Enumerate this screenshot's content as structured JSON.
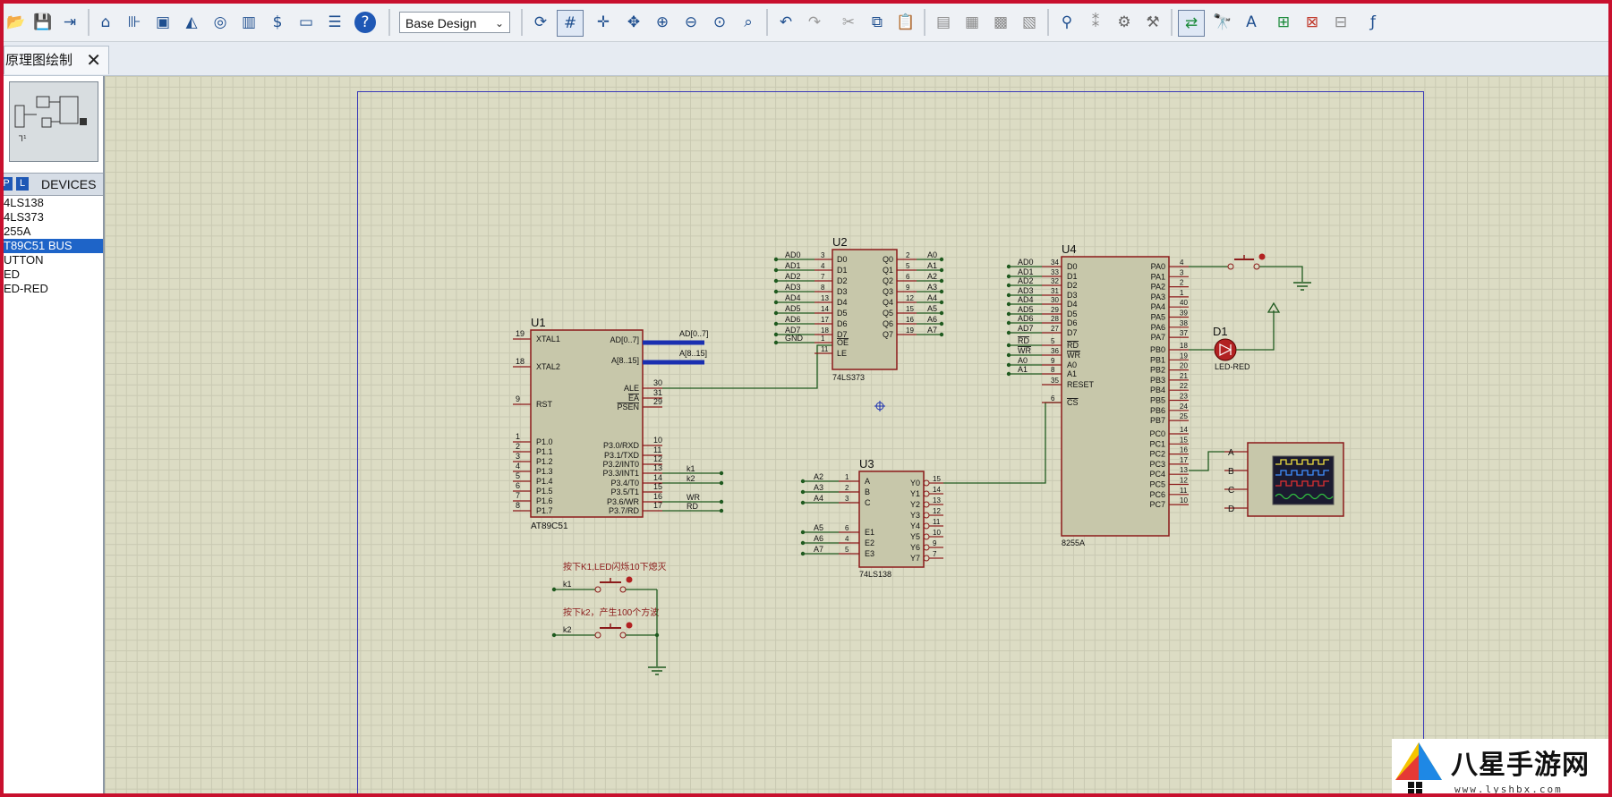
{
  "toolbar": {
    "design_select": "Base Design",
    "icons": [
      "new-folder-icon",
      "save-icon",
      "import-icon",
      "home-icon",
      "schematic-icon",
      "pcb-icon",
      "3d-icon",
      "gerber-icon",
      "bom-icon",
      "cost-icon",
      "vsm-icon",
      "netlist-icon",
      "help-icon",
      "refresh-icon",
      "grid-icon",
      "origin-icon",
      "pan-icon",
      "zoom-in-icon",
      "zoom-out-icon",
      "zoom-all-icon",
      "zoom-area-icon",
      "undo-icon",
      "redo-icon",
      "cut-icon",
      "copy-icon",
      "paste-icon",
      "block-copy-icon",
      "block-move-icon",
      "block-rotate-icon",
      "block-delete-icon",
      "pick-device-icon",
      "make-device-icon",
      "packaging-icon",
      "decompose-icon",
      "wire-autorouter-icon",
      "search-icon",
      "property-assign-icon",
      "new-sheet-icon",
      "delete-sheet-icon",
      "goto-sheet-icon",
      "script-icon"
    ]
  },
  "tab": {
    "title": "原理图绘制",
    "close": "✕"
  },
  "panel": {
    "p_label": "P",
    "l_label": "L",
    "devices_label": "DEVICES",
    "devices": [
      "4LS138",
      "4LS373",
      "255A",
      "T89C51 BUS",
      "UTTON",
      "ED",
      "ED-RED"
    ],
    "selected_index": 3
  },
  "schematic": {
    "u1": {
      "ref": "U1",
      "part": "AT89C51",
      "left_pins": [
        {
          "num": "19",
          "name": "XTAL1"
        },
        {
          "num": "18",
          "name": "XTAL2"
        },
        {
          "num": "9",
          "name": "RST"
        },
        {
          "num": "1",
          "name": "P1.0"
        },
        {
          "num": "2",
          "name": "P1.1"
        },
        {
          "num": "3",
          "name": "P1.2"
        },
        {
          "num": "4",
          "name": "P1.3"
        },
        {
          "num": "5",
          "name": "P1.4"
        },
        {
          "num": "6",
          "name": "P1.5"
        },
        {
          "num": "7",
          "name": "P1.6"
        },
        {
          "num": "8",
          "name": "P1.7"
        }
      ],
      "right_pins": [
        {
          "num": "",
          "name": "AD[0..7]"
        },
        {
          "num": "",
          "name": "A[8..15]"
        },
        {
          "num": "30",
          "name": "ALE"
        },
        {
          "num": "31",
          "name": "EA"
        },
        {
          "num": "29",
          "name": "PSEN"
        },
        {
          "num": "10",
          "name": "P3.0/RXD"
        },
        {
          "num": "11",
          "name": "P3.1/TXD"
        },
        {
          "num": "12",
          "name": "P3.2/INT0"
        },
        {
          "num": "13",
          "name": "P3.3/INT1"
        },
        {
          "num": "14",
          "name": "P3.4/T0"
        },
        {
          "num": "15",
          "name": "P3.5/T1"
        },
        {
          "num": "16",
          "name": "P3.6/WR"
        },
        {
          "num": "17",
          "name": "P3.7/RD"
        }
      ],
      "bus_labels": [
        "AD[0..7]",
        "A[8..15]"
      ],
      "net_labels": [
        "k1",
        "k2",
        "WR",
        "RD"
      ]
    },
    "u2": {
      "ref": "U2",
      "part": "74LS373",
      "inputs": [
        {
          "net": "AD0",
          "num": "3",
          "name": "D0"
        },
        {
          "net": "AD1",
          "num": "4",
          "name": "D1"
        },
        {
          "net": "AD2",
          "num": "7",
          "name": "D2"
        },
        {
          "net": "AD3",
          "num": "8",
          "name": "D3"
        },
        {
          "net": "AD4",
          "num": "13",
          "name": "D4"
        },
        {
          "net": "AD5",
          "num": "14",
          "name": "D5"
        },
        {
          "net": "AD6",
          "num": "17",
          "name": "D6"
        },
        {
          "net": "AD7",
          "num": "18",
          "name": "D7"
        }
      ],
      "outputs": [
        {
          "name": "Q0",
          "num": "2",
          "net": "A0"
        },
        {
          "name": "Q1",
          "num": "5",
          "net": "A1"
        },
        {
          "name": "Q2",
          "num": "6",
          "net": "A2"
        },
        {
          "name": "Q3",
          "num": "9",
          "net": "A3"
        },
        {
          "name": "Q4",
          "num": "12",
          "net": "A4"
        },
        {
          "name": "Q5",
          "num": "15",
          "net": "A5"
        },
        {
          "name": "Q6",
          "num": "16",
          "net": "A6"
        },
        {
          "name": "Q7",
          "num": "19",
          "net": "A7"
        }
      ],
      "control": [
        {
          "net": "GND",
          "num": "1",
          "name": "OE"
        },
        {
          "net": "",
          "num": "11",
          "name": "LE"
        }
      ]
    },
    "u3": {
      "ref": "U3",
      "part": "74LS138",
      "inputs": [
        {
          "net": "A2",
          "num": "1",
          "name": "A"
        },
        {
          "net": "A3",
          "num": "2",
          "name": "B"
        },
        {
          "net": "A4",
          "num": "3",
          "name": "C"
        },
        {
          "net": "A5",
          "num": "6",
          "name": "E1"
        },
        {
          "net": "A6",
          "num": "4",
          "name": "E2"
        },
        {
          "net": "A7",
          "num": "5",
          "name": "E3"
        }
      ],
      "outputs": [
        {
          "name": "Y0",
          "num": "15"
        },
        {
          "name": "Y1",
          "num": "14"
        },
        {
          "name": "Y2",
          "num": "13"
        },
        {
          "name": "Y3",
          "num": "12"
        },
        {
          "name": "Y4",
          "num": "11"
        },
        {
          "name": "Y5",
          "num": "10"
        },
        {
          "name": "Y6",
          "num": "9"
        },
        {
          "name": "Y7",
          "num": "7"
        }
      ]
    },
    "u4": {
      "ref": "U4",
      "part": "8255A",
      "left_pins": [
        {
          "net": "AD0",
          "num": "34",
          "name": "D0"
        },
        {
          "net": "AD1",
          "num": "33",
          "name": "D1"
        },
        {
          "net": "AD2",
          "num": "32",
          "name": "D2"
        },
        {
          "net": "AD3",
          "num": "31",
          "name": "D3"
        },
        {
          "net": "AD4",
          "num": "30",
          "name": "D4"
        },
        {
          "net": "AD5",
          "num": "29",
          "name": "D5"
        },
        {
          "net": "AD6",
          "num": "28",
          "name": "D6"
        },
        {
          "net": "AD7",
          "num": "27",
          "name": "D7"
        },
        {
          "net": "RD",
          "num": "5",
          "name": "RD"
        },
        {
          "net": "WR",
          "num": "36",
          "name": "WR"
        },
        {
          "net": "A0",
          "num": "9",
          "name": "A0"
        },
        {
          "net": "A1",
          "num": "8",
          "name": "A1"
        },
        {
          "net": "",
          "num": "35",
          "name": "RESET"
        },
        {
          "net": "",
          "num": "6",
          "name": "CS"
        }
      ],
      "right_pins": [
        {
          "name": "PA0",
          "num": "4"
        },
        {
          "name": "PA1",
          "num": "3"
        },
        {
          "name": "PA2",
          "num": "2"
        },
        {
          "name": "PA3",
          "num": "1"
        },
        {
          "name": "PA4",
          "num": "40"
        },
        {
          "name": "PA5",
          "num": "39"
        },
        {
          "name": "PA6",
          "num": "38"
        },
        {
          "name": "PA7",
          "num": "37"
        },
        {
          "name": "PB0",
          "num": "18"
        },
        {
          "name": "PB1",
          "num": "19"
        },
        {
          "name": "PB2",
          "num": "20"
        },
        {
          "name": "PB3",
          "num": "21"
        },
        {
          "name": "PB4",
          "num": "22"
        },
        {
          "name": "PB5",
          "num": "23"
        },
        {
          "name": "PB6",
          "num": "24"
        },
        {
          "name": "PB7",
          "num": "25"
        },
        {
          "name": "PC0",
          "num": "14"
        },
        {
          "name": "PC1",
          "num": "15"
        },
        {
          "name": "PC2",
          "num": "16"
        },
        {
          "name": "PC3",
          "num": "17"
        },
        {
          "name": "PC4",
          "num": "13"
        },
        {
          "name": "PC5",
          "num": "12"
        },
        {
          "name": "PC6",
          "num": "11"
        },
        {
          "name": "PC7",
          "num": "10"
        }
      ]
    },
    "d1": {
      "ref": "D1",
      "part": "LED-RED"
    },
    "scope_channels": [
      "A",
      "B",
      "C",
      "D"
    ],
    "notes": [
      {
        "text": "按下K1,LED闪烁10下熄灭",
        "net": "k1"
      },
      {
        "text": "按下k2，产生100个方波",
        "net": "k2"
      }
    ]
  },
  "watermark": {
    "text": "八星手游网",
    "url": "www.lyshbx.com"
  }
}
